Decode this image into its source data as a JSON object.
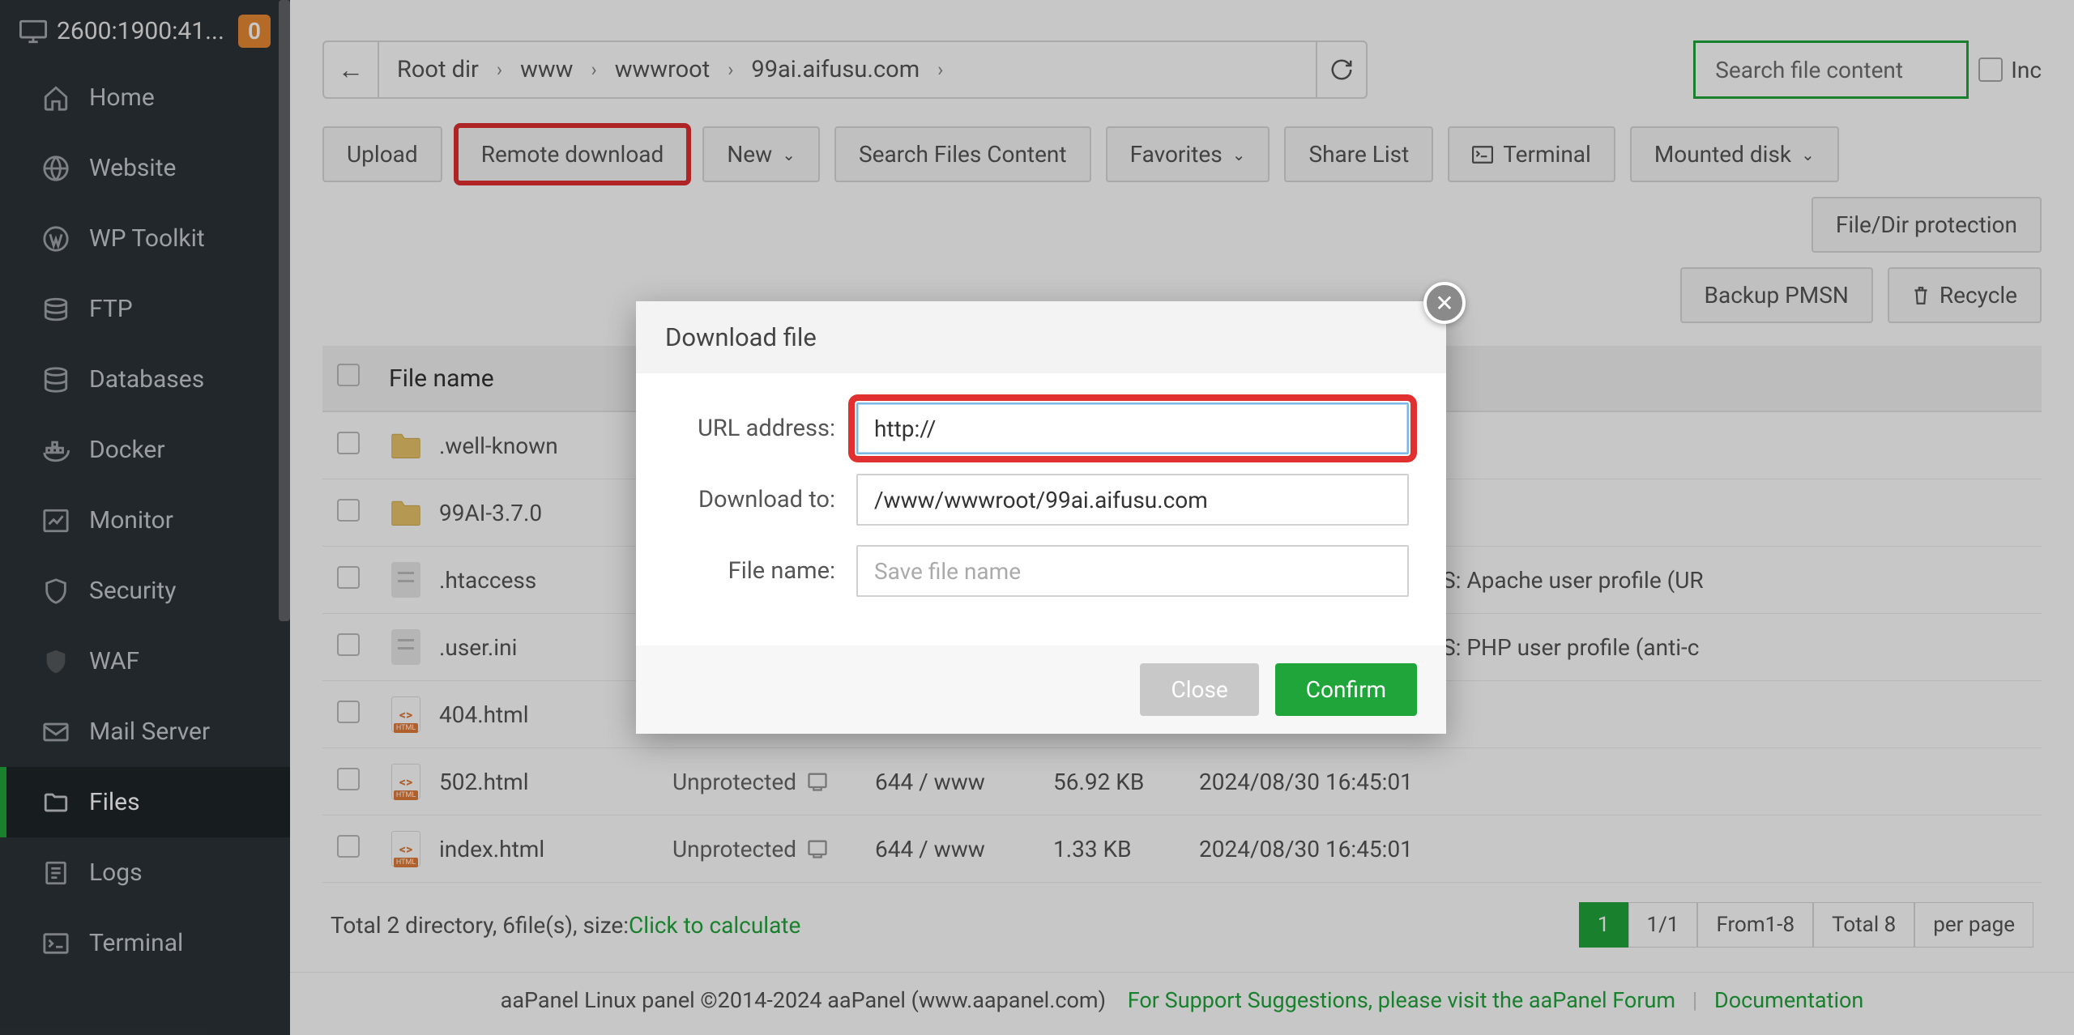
{
  "header": {
    "ip": "2600:1900:41...",
    "badge": "0"
  },
  "sidebar": {
    "items": [
      {
        "label": "Home",
        "icon": "home"
      },
      {
        "label": "Website",
        "icon": "globe"
      },
      {
        "label": "WP Toolkit",
        "icon": "wordpress"
      },
      {
        "label": "FTP",
        "icon": "ftp"
      },
      {
        "label": "Databases",
        "icon": "database"
      },
      {
        "label": "Docker",
        "icon": "docker"
      },
      {
        "label": "Monitor",
        "icon": "chart"
      },
      {
        "label": "Security",
        "icon": "shield"
      },
      {
        "label": "WAF",
        "icon": "waf"
      },
      {
        "label": "Mail Server",
        "icon": "mail"
      },
      {
        "label": "Files",
        "icon": "folder",
        "active": true
      },
      {
        "label": "Logs",
        "icon": "logs"
      },
      {
        "label": "Terminal",
        "icon": "terminal"
      }
    ]
  },
  "breadcrumb": {
    "parts": [
      "Root dir",
      "www",
      "wwwroot",
      "99ai.aifusu.com"
    ]
  },
  "search": {
    "placeholder": "Search file content",
    "inc_label": "Inc"
  },
  "toolbar": {
    "upload": "Upload",
    "remote_download": "Remote download",
    "new": "New",
    "search_files": "Search Files Content",
    "favorites": "Favorites",
    "share_list": "Share List",
    "terminal": "Terminal",
    "mounted_disk": "Mounted disk",
    "file_dir_protection": "File/Dir protection",
    "backup_pmsn": "Backup PMSN",
    "recycle": "Recycle"
  },
  "table": {
    "header": {
      "filename": "File name"
    },
    "rows": [
      {
        "name": ".well-known",
        "type": "folder"
      },
      {
        "name": "99AI-3.7.0",
        "type": "folder"
      },
      {
        "name": ".htaccess",
        "type": "text",
        "ps": "S: Apache user profile (UR"
      },
      {
        "name": ".user.ini",
        "type": "text",
        "ps": "S: PHP user profile (anti-c"
      },
      {
        "name": "404.html",
        "type": "html"
      },
      {
        "name": "502.html",
        "type": "html",
        "protect": "Unprotected",
        "perm": "644 / www",
        "size": "56.92 KB",
        "mtime": "2024/08/30 16:45:01"
      },
      {
        "name": "index.html",
        "type": "html",
        "protect": "Unprotected",
        "perm": "644 / www",
        "size": "1.33 KB",
        "mtime": "2024/08/30 16:45:01"
      }
    ]
  },
  "footer": {
    "summary_prefix": "Total 2 directory, 6file(s), size: ",
    "calc_link": "Click to calculate",
    "pagination": {
      "current": "1",
      "pages": "1/1",
      "range": "From1-8",
      "total": "Total 8",
      "per_page": "per page"
    }
  },
  "bottom": {
    "copyright": "aaPanel Linux panel ©2014-2024 aaPanel (www.aapanel.com)",
    "forum": "For Support Suggestions, please visit the aaPanel Forum",
    "docs": "Documentation"
  },
  "modal": {
    "title": "Download file",
    "url_label": "URL address:",
    "url_value": "http://",
    "download_to_label": "Download to:",
    "download_to_value": "/www/wwwroot/99ai.aifusu.com",
    "filename_label": "File name:",
    "filename_placeholder": "Save file name",
    "close": "Close",
    "confirm": "Confirm"
  }
}
